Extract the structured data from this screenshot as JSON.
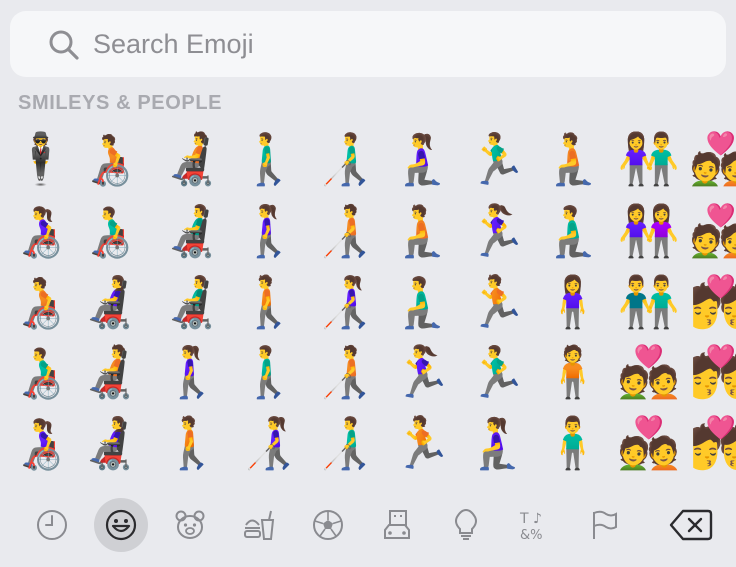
{
  "search": {
    "placeholder": "Search Emoji"
  },
  "section": {
    "title": "SMILEYS & PEOPLE"
  },
  "emoji_rows": [
    [
      "🕴",
      "🧑‍🦽",
      "🧑‍🦼",
      "🚶‍♂️",
      "👨‍🦯",
      "🧎‍♀️",
      "🏃‍♂️",
      "🧎",
      "👫",
      "💑"
    ],
    [
      "👩‍🦽",
      "👨‍🦽",
      "👨‍🦼",
      "🚶‍♀️",
      "🧑‍🦯",
      "🧎",
      "🏃‍♀️",
      "🧎‍♂️",
      "👭",
      "💑"
    ],
    [
      "🧑‍🦽",
      "👩‍🦼",
      "👨‍🦼",
      "🚶",
      "👩‍🦯",
      "🧎‍♂️",
      "🏃",
      "🧍‍♀️",
      "👬",
      "💏"
    ],
    [
      "👨‍🦽",
      "🧑‍🦼",
      "🚶‍♀️",
      "🚶‍♂️",
      "🧑‍🦯",
      "🏃‍♀️",
      "🏃‍♂️",
      "🧍",
      "💑",
      "💏"
    ],
    [
      "👩‍🦽",
      "👩‍🦼",
      "🚶",
      "👩‍🦯",
      "👨‍🦯",
      "🏃",
      "🧎‍♀️",
      "🧍‍♂️",
      "💑",
      "💏"
    ]
  ],
  "tabs": [
    {
      "name": "recent",
      "icon": "clock-icon",
      "active": false
    },
    {
      "name": "smileys-people",
      "icon": "smiley-icon",
      "active": true
    },
    {
      "name": "animals-nature",
      "icon": "bear-icon",
      "active": false
    },
    {
      "name": "food-drink",
      "icon": "burger-drink-icon",
      "active": false
    },
    {
      "name": "activity",
      "icon": "soccer-ball-icon",
      "active": false
    },
    {
      "name": "travel-places",
      "icon": "car-building-icon",
      "active": false
    },
    {
      "name": "objects",
      "icon": "lightbulb-icon",
      "active": false
    },
    {
      "name": "symbols",
      "icon": "symbols-icon",
      "active": false
    },
    {
      "name": "flags",
      "icon": "flag-icon",
      "active": false
    }
  ],
  "delete_key": {
    "icon": "delete-backward-icon"
  },
  "colors": {
    "background": "#e9eaee",
    "search_field": "#f6f7f9",
    "icon": "#8a8b90",
    "active_tab": "#cfd0d4",
    "placeholder": "#8e8e93"
  }
}
